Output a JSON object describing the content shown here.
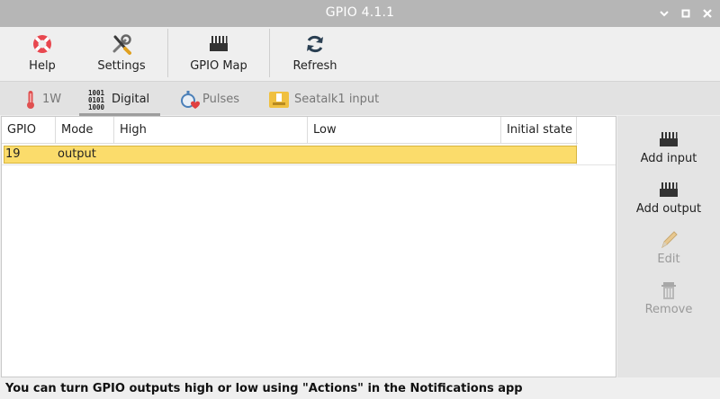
{
  "window": {
    "title": "GPIO 4.1.1",
    "controls": [
      "minimize",
      "maximize",
      "close"
    ]
  },
  "toolbar": {
    "help_label": "Help",
    "settings_label": "Settings",
    "gpio_map_label": "GPIO Map",
    "refresh_label": "Refresh"
  },
  "tabs": [
    {
      "label": "1W",
      "icon": "thermometer-icon",
      "active": false
    },
    {
      "label": "Digital",
      "icon": "binary-digits-icon",
      "active": true
    },
    {
      "label": "Pulses",
      "icon": "stopwatch-heart-icon",
      "active": false
    },
    {
      "label": "Seatalk1 input",
      "icon": "seatalk-icon",
      "active": false
    }
  ],
  "table": {
    "columns": [
      "GPIO",
      "Mode",
      "High",
      "Low",
      "Initial state"
    ],
    "rows": [
      {
        "gpio": "19",
        "mode": "output",
        "high": "",
        "low": "",
        "initial_state": "",
        "selected": true
      }
    ],
    "selected_row_color": "#fbdc6b"
  },
  "actions": {
    "add_input_label": "Add input",
    "add_output_label": "Add output",
    "edit_label": "Edit",
    "remove_label": "Remove"
  },
  "status": {
    "message": "You can turn GPIO outputs high or low using \"Actions\" in the Notifications app"
  },
  "colors": {
    "titlebar": "#b6b6b6",
    "help_icon": "#e8474f",
    "refresh_icon": "#2a3f52"
  }
}
